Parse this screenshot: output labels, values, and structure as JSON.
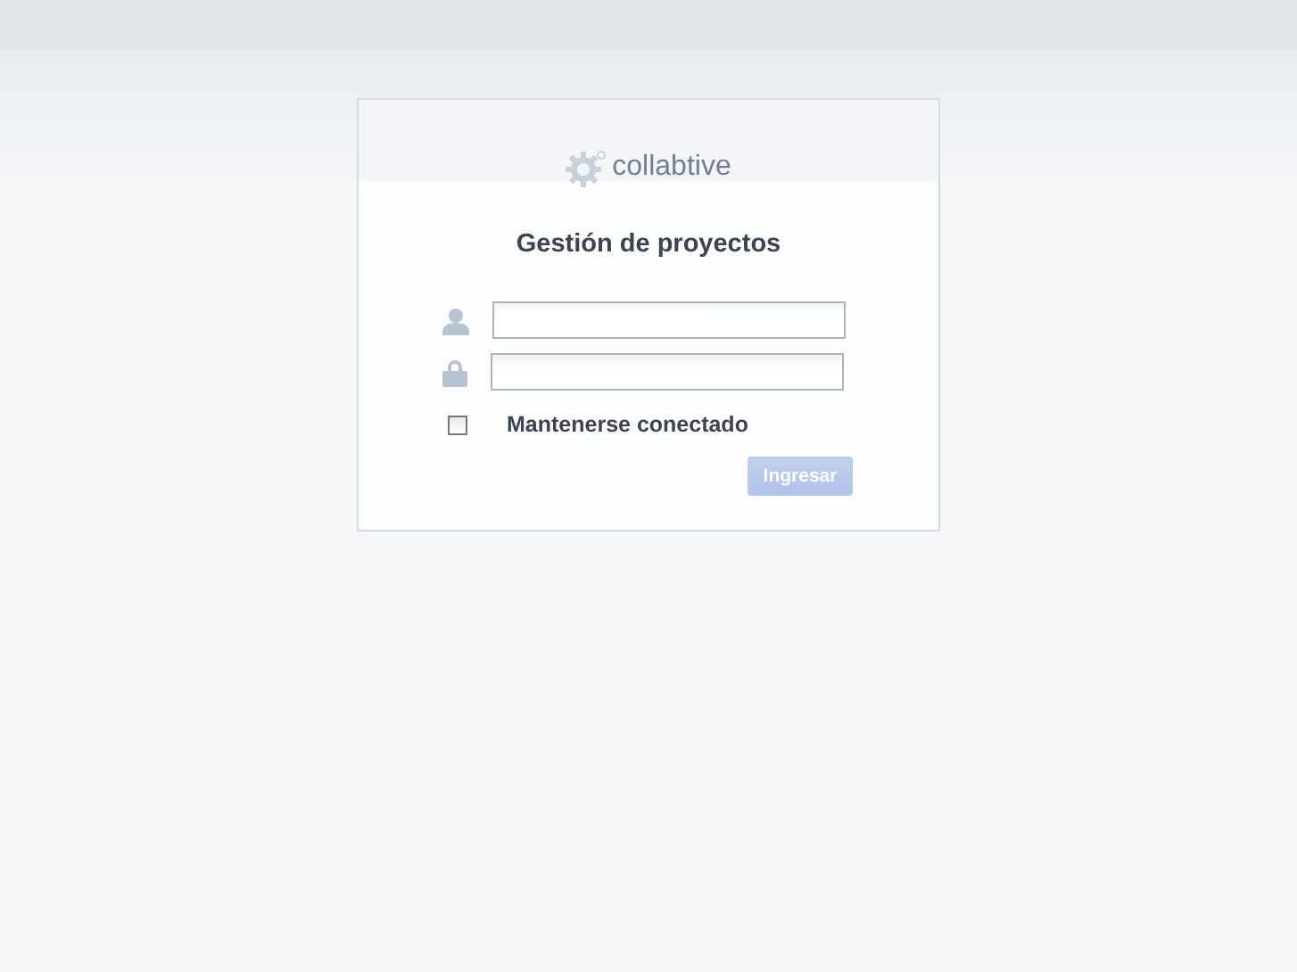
{
  "logo": {
    "text": "collabtive"
  },
  "title": "Gestión de proyectos",
  "fields": [
    {
      "kind": "user"
    },
    {
      "kind": "password"
    }
  ],
  "remember": {
    "label": "Mantenerse conectado",
    "checked": false
  },
  "submit": {
    "label": "Ingresar",
    "disabled": true
  }
}
